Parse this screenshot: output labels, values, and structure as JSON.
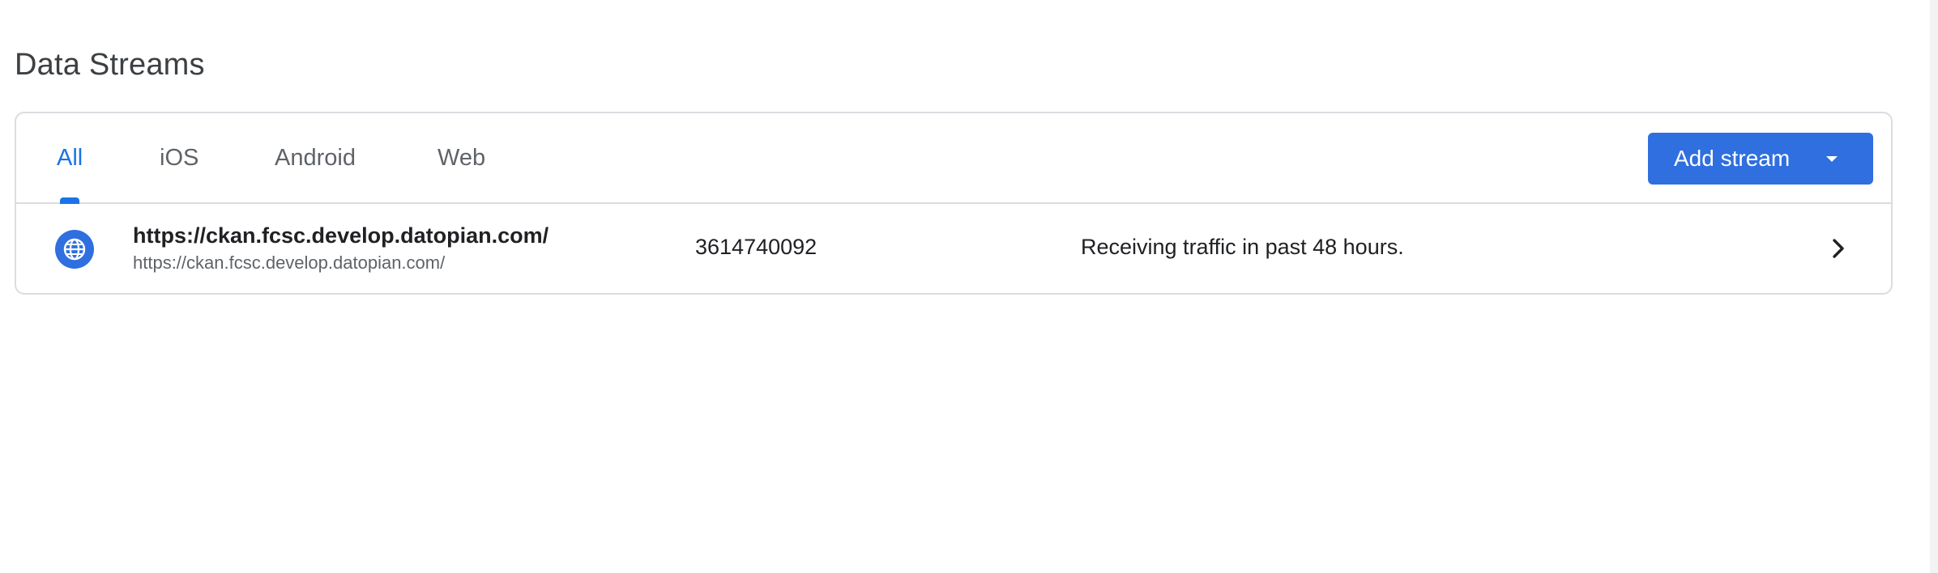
{
  "page": {
    "title": "Data Streams"
  },
  "tabs": [
    {
      "label": "All",
      "active": true
    },
    {
      "label": "iOS",
      "active": false
    },
    {
      "label": "Android",
      "active": false
    },
    {
      "label": "Web",
      "active": false
    }
  ],
  "toolbar": {
    "add_stream_label": "Add stream",
    "add_stream_icon": "arrow-drop-down-icon"
  },
  "streams": [
    {
      "icon": "globe-icon",
      "name": "https://ckan.fcsc.develop.datopian.com/",
      "url": "https://ckan.fcsc.develop.datopian.com/",
      "stream_id": "3614740092",
      "status": "Receiving traffic in past 48 hours.",
      "action_icon": "chevron-right-icon"
    }
  ],
  "colors": {
    "accent": "#1a73e8",
    "button_bg": "#2f6fdf",
    "border": "#dadce0",
    "text_primary": "#202124",
    "text_secondary": "#5f6368"
  }
}
